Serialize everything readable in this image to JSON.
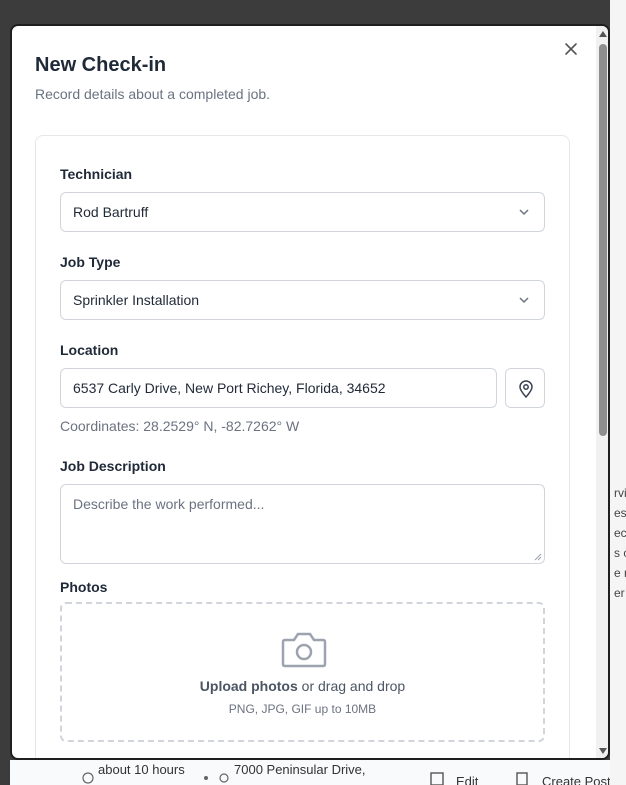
{
  "modal": {
    "title": "New Check-in",
    "subtitle": "Record details about a completed job.",
    "close_icon": "close-icon"
  },
  "form": {
    "technician": {
      "label": "Technician",
      "value": "Rod Bartruff"
    },
    "job_type": {
      "label": "Job Type",
      "value": "Sprinkler Installation"
    },
    "location": {
      "label": "Location",
      "value": "6537 Carly Drive, New Port Richey, Florida, 34652",
      "coordinates": "Coordinates: 28.2529° N, -82.7262° W",
      "pin_icon": "map-pin-icon"
    },
    "job_description": {
      "label": "Job Description",
      "placeholder": "Describe the work performed..."
    },
    "photos": {
      "label": "Photos",
      "upload_link": "Upload photos",
      "upload_rest": "or drag and drop",
      "hint": "PNG, JPG, GIF up to 10MB",
      "icon": "camera-icon"
    }
  },
  "background": {
    "right_fragments": [
      "rvi",
      "es",
      "ec",
      "s c",
      "e r",
      "er"
    ],
    "bottom": {
      "time": "about 10 hours",
      "address": "7000 Peninsular Drive,",
      "edit_label": "Edit",
      "create_post_label": "Create Post"
    }
  },
  "colors": {
    "accent": "#1f2937",
    "muted": "#6b7280",
    "border": "#d1d5db"
  }
}
